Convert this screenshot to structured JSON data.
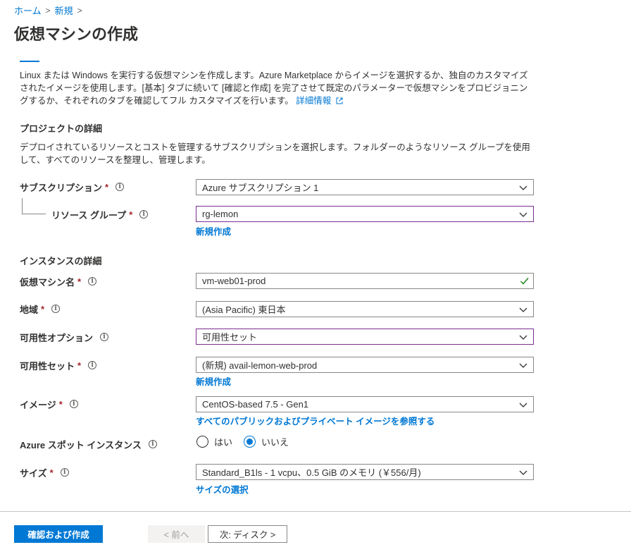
{
  "breadcrumb": {
    "home": "ホーム",
    "new": "新規",
    "sep": ">"
  },
  "page": {
    "title": "仮想マシンの作成"
  },
  "intro": {
    "text": "Linux または Windows を実行する仮想マシンを作成します。Azure Marketplace からイメージを選択するか、独自のカスタマイズされたイメージを使用します。[基本] タブに続いて [確認と作成] を完了させて既定のパラメーターで仮想マシンをプロビジョニングするか、それぞれのタブを確認してフル カスタマイズを行います。",
    "link": "詳細情報"
  },
  "project": {
    "heading": "プロジェクトの詳細",
    "description": "デプロイされているリソースとコストを管理するサブスクリプションを選択します。フォルダーのようなリソース グループを使用して、すべてのリソースを整理し、管理します。",
    "subscription": {
      "label": "サブスクリプション",
      "value": "Azure サブスクリプション 1"
    },
    "resource_group": {
      "label": "リソース グループ",
      "value": "rg-lemon",
      "create_link": "新規作成"
    }
  },
  "instance": {
    "heading": "インスタンスの詳細",
    "vm_name": {
      "label": "仮想マシン名",
      "value": "vm-web01-prod"
    },
    "region": {
      "label": "地域",
      "value": "(Asia Pacific) 東日本"
    },
    "availability_option": {
      "label": "可用性オプション",
      "value": "可用性セット"
    },
    "availability_set": {
      "label": "可用性セット",
      "value": "(新規) avail-lemon-web-prod",
      "create_link": "新規作成"
    },
    "image": {
      "label": "イメージ",
      "value": "CentOS-based 7.5 - Gen1",
      "browse_link": "すべてのパブリックおよびプライベート イメージを参照する"
    },
    "spot": {
      "label": "Azure スポット インスタンス",
      "yes": "はい",
      "no": "いいえ",
      "selected": "no"
    },
    "size": {
      "label": "サイズ",
      "value": "Standard_B1ls - 1 vcpu、0.5 GiB のメモリ (￥556/月)",
      "select_link": "サイズの選択"
    }
  },
  "required_mark": "*",
  "info_glyph": "i",
  "footer": {
    "review_create": "確認および作成",
    "previous": "< 前へ",
    "next": "次: ディスク >"
  },
  "colors": {
    "accent": "#0078d4",
    "required": "#a4262c",
    "valid": "#107c10",
    "focus_border": "#7b2f8f"
  }
}
